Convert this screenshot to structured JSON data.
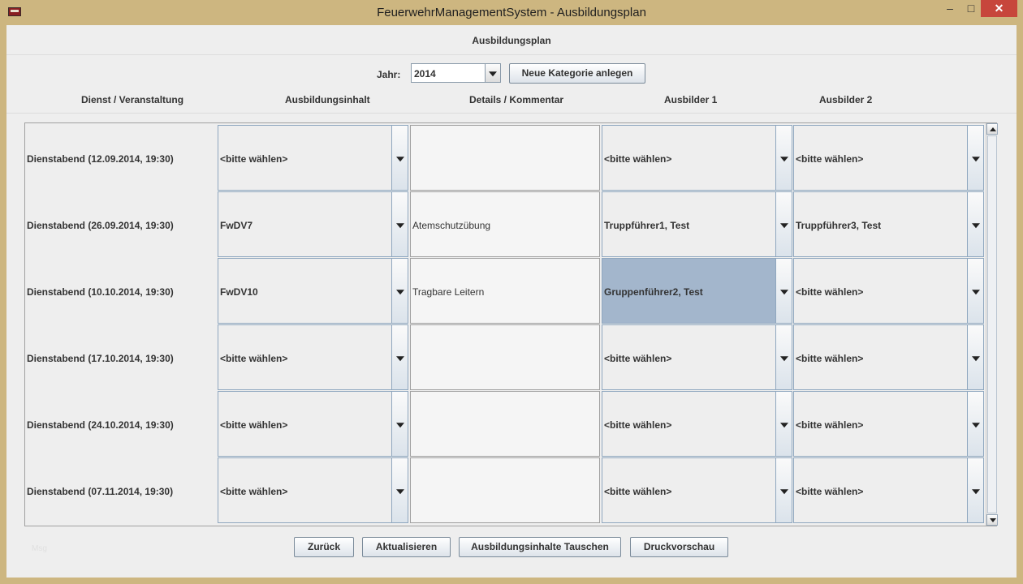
{
  "window": {
    "title": "FeuerwehrManagementSystem - Ausbildungsplan",
    "minimize_glyph": "–",
    "maximize_glyph": "□",
    "close_glyph": "✕",
    "icon": "app-icon"
  },
  "heading": "Ausbildungsplan",
  "year": {
    "label": "Jahr:",
    "value": "2014"
  },
  "new_category_button": "Neue Kategorie anlegen",
  "columns": {
    "event": "Dienst / Veranstaltung",
    "content": "Ausbildungsinhalt",
    "details": "Details / Kommentar",
    "trainer1": "Ausbilder 1",
    "trainer2": "Ausbilder 2"
  },
  "rows": [
    {
      "event": "Dienstabend (12.09.2014, 19:30)",
      "content": "<bitte wählen>",
      "details": "",
      "trainer1": "<bitte wählen>",
      "trainer2": "<bitte wählen>"
    },
    {
      "event": "Dienstabend (26.09.2014, 19:30)",
      "content": "FwDV7",
      "details": "Atemschutzübung",
      "trainer1": "Truppführer1, Test",
      "trainer2": "Truppführer3, Test"
    },
    {
      "event": "Dienstabend (10.10.2014, 19:30)",
      "content": "FwDV10",
      "details": "Tragbare Leitern",
      "trainer1": "Gruppenführer2, Test",
      "trainer2": "<bitte wählen>"
    },
    {
      "event": "Dienstabend (17.10.2014, 19:30)",
      "content": "<bitte wählen>",
      "details": "",
      "trainer1": "<bitte wählen>",
      "trainer2": "<bitte wählen>"
    },
    {
      "event": "Dienstabend (24.10.2014, 19:30)",
      "content": "<bitte wählen>",
      "details": "",
      "trainer1": "<bitte wählen>",
      "trainer2": "<bitte wählen>"
    },
    {
      "event": "Dienstabend (07.11.2014, 19:30)",
      "content": "<bitte wählen>",
      "details": "",
      "trainer1": "<bitte wählen>",
      "trainer2": "<bitte wählen>"
    }
  ],
  "buttons": {
    "back": "Zurück",
    "refresh": "Aktualisieren",
    "swap": "Ausbildungsinhalte Tauschen",
    "preview": "Druckvorschau"
  },
  "faint_label": "Msg"
}
